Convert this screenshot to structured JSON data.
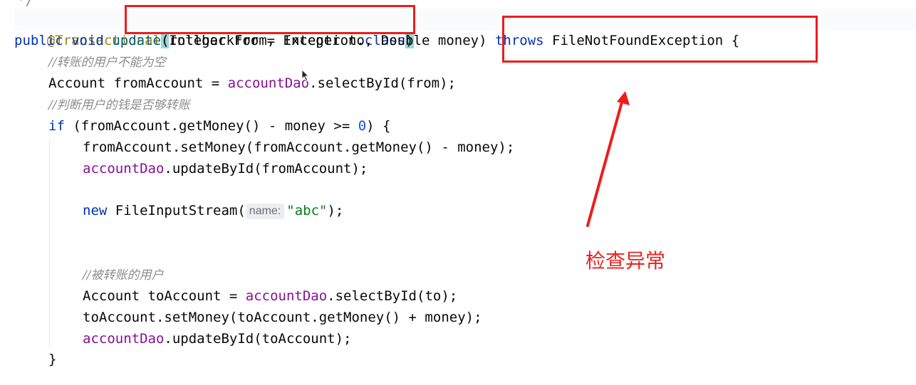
{
  "code": {
    "top_stub": "*/",
    "l1": {
      "annotation": "@Transactional",
      "paren_open": "(",
      "args": "rollbackFor = Exception.",
      "class_kw": "class",
      "paren_close": ")"
    },
    "l2": {
      "public": "public",
      "void": "void",
      "method": "update",
      "params": "(Integer from, Integer to, Double money) ",
      "throws": "throws",
      "exception": " FileNotFoundException {"
    },
    "l3": {
      "comment": "//转账的用户不能为空"
    },
    "l4": {
      "pre": "Account fromAccount = ",
      "field": "accountDao",
      "post": ".selectById(from);"
    },
    "l5": {
      "comment": "//判断用户的钱是否够转账"
    },
    "l6": {
      "if": "if",
      "pre": " (fromAccount.getMoney() - money >= ",
      "num": "0",
      "post": ") {"
    },
    "l7": {
      "text": "fromAccount.setMoney(fromAccount.getMoney() - money);"
    },
    "l8": {
      "field": "accountDao",
      "post": ".updateById(fromAccount);"
    },
    "l9": {
      "new": "new",
      "pre": " FileInputStream(",
      "hint": "name:",
      "str": "\"abc\"",
      "post": ");"
    },
    "l10": {
      "comment": "//被转账的用户"
    },
    "l11": {
      "pre": "Account toAccount = ",
      "field": "accountDao",
      "post": ".selectById(to);"
    },
    "l12": {
      "text": "toAccount.setMoney(toAccount.getMoney() + money);"
    },
    "l13": {
      "field": "accountDao",
      "post": ".updateById(toAccount);"
    },
    "l14": {
      "text": "}"
    }
  },
  "annotation_note": "检查异常",
  "colors": {
    "highlight_box": "#ee1c1c",
    "note_text": "#e8231f"
  }
}
